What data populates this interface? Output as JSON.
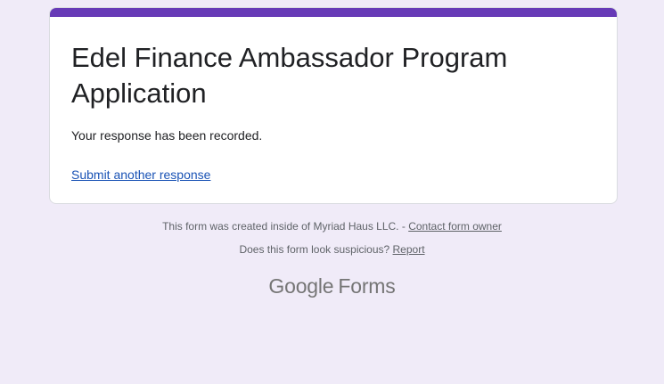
{
  "form": {
    "title": "Edel Finance Ambassador Program Application",
    "confirmation": "Your response has been recorded.",
    "submit_another_label": "Submit another response"
  },
  "footer": {
    "created_inside_text": "This form was created inside of Myriad Haus LLC. - ",
    "contact_owner_label": "Contact form owner",
    "suspicious_text": "Does this form look suspicious? ",
    "report_label": "Report"
  },
  "branding": {
    "google": "Google",
    "forms": "Forms"
  },
  "colors": {
    "accent": "#673ab7",
    "background": "#f0ebf8",
    "link": "#1a53b5"
  }
}
